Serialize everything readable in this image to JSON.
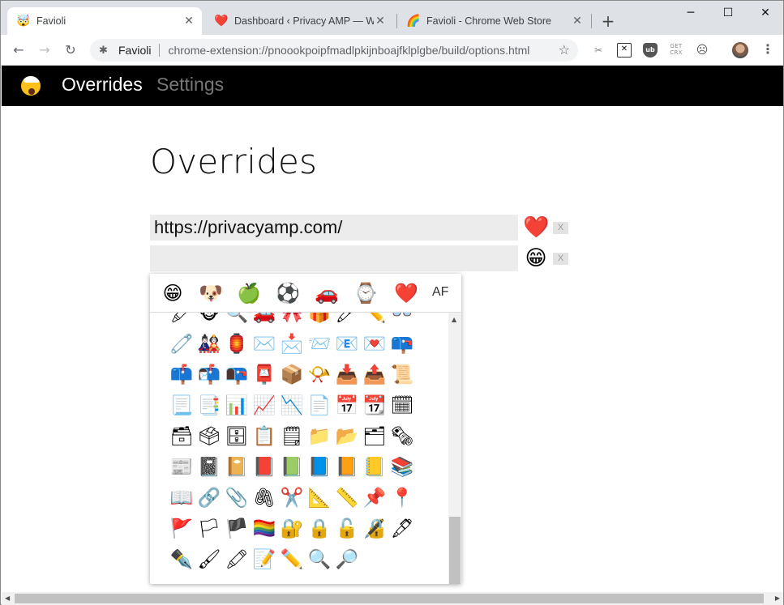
{
  "tabs": [
    {
      "icon": "🤯",
      "title": "Favioli",
      "active": true
    },
    {
      "icon": "❤️",
      "title": "Dashboard ‹ Privacy AMP — WordPress",
      "active": false
    },
    {
      "icon": "🌈",
      "title": "Favioli - Chrome Web Store",
      "active": false
    }
  ],
  "toolbar": {
    "site": "Favioli",
    "url": "chrome-extension://pnoookpoipfmadlpkijnboajfklplgbe/build/options.html",
    "ext_crx_line1": "GET",
    "ext_crx_line2": "CRX",
    "ext_ub_label": "ub"
  },
  "app": {
    "nav_overrides": "Overrides",
    "nav_settings": "Settings"
  },
  "page": {
    "heading": "Overrides",
    "rows": [
      {
        "value": "https://privacyamp.com/",
        "emoji": "❤️",
        "remove": "X"
      },
      {
        "value": "",
        "emoji": "😁",
        "remove": "X"
      }
    ]
  },
  "picker": {
    "categories": [
      "😁",
      "🐶",
      "🍏",
      "⚽",
      "🚗",
      "⌚",
      "❤️"
    ],
    "cat_af": "AF",
    "grid": [
      [
        "🖍",
        "🐵",
        "🔍",
        "🚗",
        "🎀",
        "🎁",
        "🖊",
        "✏️",
        "👓"
      ],
      [
        "🧷",
        "🎎",
        "🏮",
        "✉️",
        "📩",
        "📨",
        "📧",
        "💌",
        "📪"
      ],
      [
        "📫",
        "📬",
        "📭",
        "📮",
        "📦",
        "📯",
        "📥",
        "📤",
        "📜"
      ],
      [
        "📃",
        "📑",
        "📊",
        "📈",
        "📉",
        "📄",
        "📅",
        "📆",
        "🗓"
      ],
      [
        "🗃",
        "🗳",
        "🗄",
        "📋",
        "🗒",
        "📁",
        "📂",
        "🗂",
        "🗞"
      ],
      [
        "📰",
        "📓",
        "📔",
        "📕",
        "📗",
        "📘",
        "📙",
        "📒",
        "📚"
      ],
      [
        "📖",
        "🔗",
        "📎",
        "🖇",
        "✂️",
        "📐",
        "📏",
        "📌",
        "📍"
      ],
      [
        "🚩",
        "🏳",
        "🏴",
        "🏳️‍🌈",
        "🔐",
        "🔒",
        "🔓",
        "🔏",
        "🖋"
      ],
      [
        "✒️",
        "🖌",
        "🖍",
        "📝",
        "✏️",
        "🔍",
        "🔎",
        "",
        ""
      ]
    ]
  }
}
